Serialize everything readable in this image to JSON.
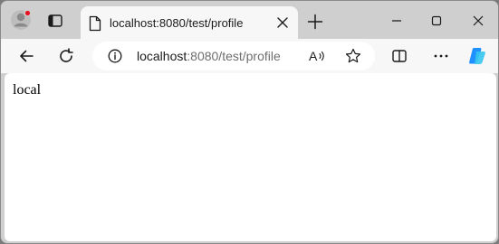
{
  "tab": {
    "title": "localhost:8080/test/profile"
  },
  "address_bar": {
    "host": "localhost",
    "rest": ":8080/test/profile"
  },
  "icons": {
    "profile": "profile-icon",
    "tab_actions": "tab-actions-icon",
    "favicon": "page-icon",
    "close_tab": "close-icon",
    "new_tab": "plus-icon",
    "minimize": "minimize-icon",
    "maximize": "maximize-icon",
    "close_window": "close-icon",
    "back": "back-arrow-icon",
    "refresh": "refresh-icon",
    "site_info": "info-icon",
    "read_aloud": "read-aloud-icon",
    "favorite": "star-icon",
    "split_screen": "split-screen-icon",
    "more": "more-icon",
    "copilot": "copilot-icon"
  },
  "colors": {
    "chrome": "#cfcfcf",
    "toolbar": "#f7f7f7",
    "profile_badge": "#e81123",
    "copilot_primary": "#1e90ff",
    "copilot_secondary": "#36c5f0"
  },
  "page": {
    "text": "local"
  }
}
